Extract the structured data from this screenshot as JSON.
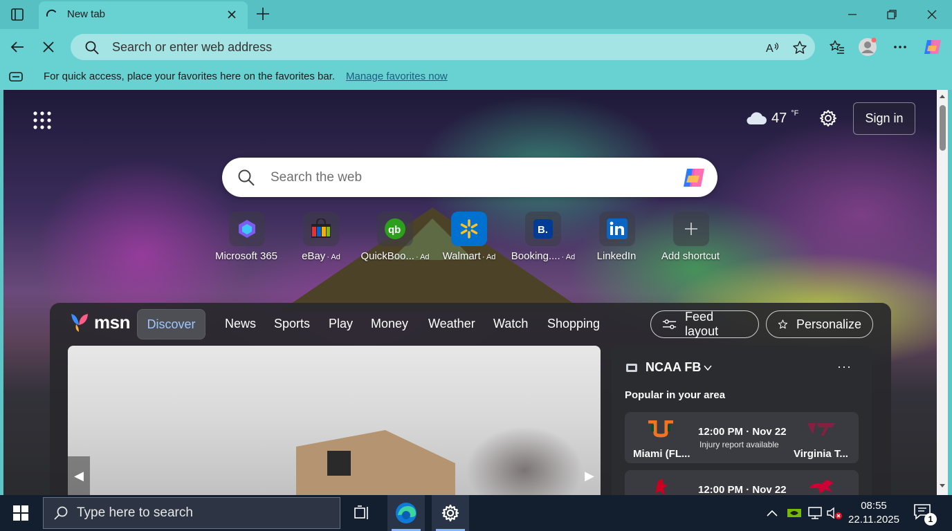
{
  "browser": {
    "tab": {
      "title": "New tab"
    },
    "omnibox": {
      "placeholder": "Search or enter web address"
    },
    "favorites_bar": {
      "message": "For quick access, place your favorites here on the favorites bar.",
      "link": "Manage favorites now"
    }
  },
  "newtab": {
    "weather": {
      "temp": "47",
      "unit": "°F",
      "icon": "cloud-icon"
    },
    "sign_in_label": "Sign in",
    "search": {
      "placeholder": "Search the web"
    },
    "shortcuts": [
      {
        "label": "Microsoft 365",
        "ad": ""
      },
      {
        "label": "eBay",
        "ad": "· Ad"
      },
      {
        "label": "QuickBoo...",
        "ad": "· Ad"
      },
      {
        "label": "Walmart",
        "ad": "· Ad"
      },
      {
        "label": "Booking....",
        "ad": "· Ad"
      },
      {
        "label": "LinkedIn",
        "ad": ""
      },
      {
        "label": "Add shortcut",
        "ad": ""
      }
    ]
  },
  "msn": {
    "logo_text": "msn",
    "nav": [
      "Discover",
      "News",
      "Sports",
      "Play",
      "Money",
      "Weather",
      "Watch",
      "Shopping"
    ],
    "feed_layout_label": "Feed layout",
    "personalize_label": "Personalize",
    "sports": {
      "league": "NCAA FB",
      "more": "···",
      "subtitle": "Popular in your area",
      "games": [
        {
          "team1": "Miami (FL...",
          "team2": "Virginia T...",
          "time": "12:00 PM · Nov 22",
          "status": "Injury report available"
        },
        {
          "team1": "",
          "team2": "",
          "time": "12:00 PM · Nov 22",
          "status": ""
        }
      ]
    }
  },
  "taskbar": {
    "search_placeholder": "Type here to search",
    "time": "08:55",
    "date": "22.11.2025",
    "notification_count": "1"
  },
  "colors": {
    "browser_frame": "#68d1d2",
    "title_bar": "#56c0c2",
    "msn_discover": "#9fc6ff",
    "taskbar": "#131e2e"
  }
}
